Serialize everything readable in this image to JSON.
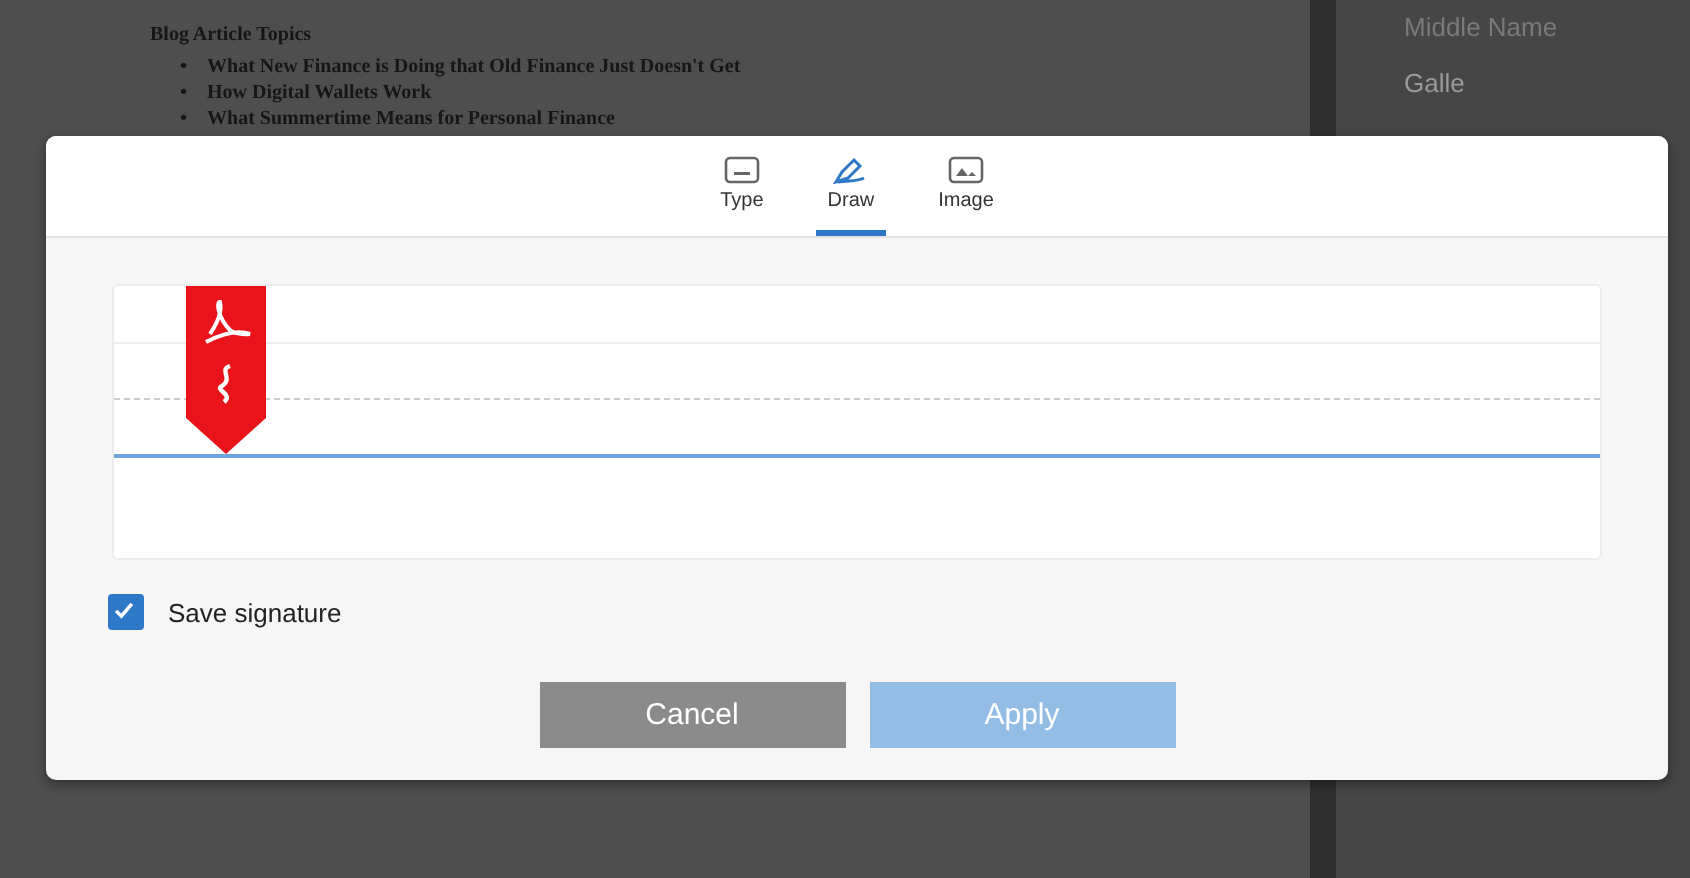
{
  "document": {
    "heading": "Blog Article Topics",
    "items": [
      {
        "marker": "•",
        "text": "What New Finance is Doing that Old Finance Just Doesn't Get"
      },
      {
        "marker": "•",
        "text": "How Digital Wallets Work"
      },
      {
        "marker": "•",
        "text": "What Summertime Means for Personal Finance"
      }
    ]
  },
  "side_panel": {
    "label": "Middle Name",
    "value": "Galle"
  },
  "dialog": {
    "tabs": [
      {
        "label": "Type",
        "selected": false
      },
      {
        "label": "Draw",
        "selected": true
      },
      {
        "label": "Image",
        "selected": false
      }
    ],
    "save_signature": {
      "label": "Save signature",
      "checked": true
    },
    "buttons": [
      {
        "label": "Cancel",
        "kind": "secondary"
      },
      {
        "label": "Apply",
        "kind": "primary"
      }
    ]
  }
}
